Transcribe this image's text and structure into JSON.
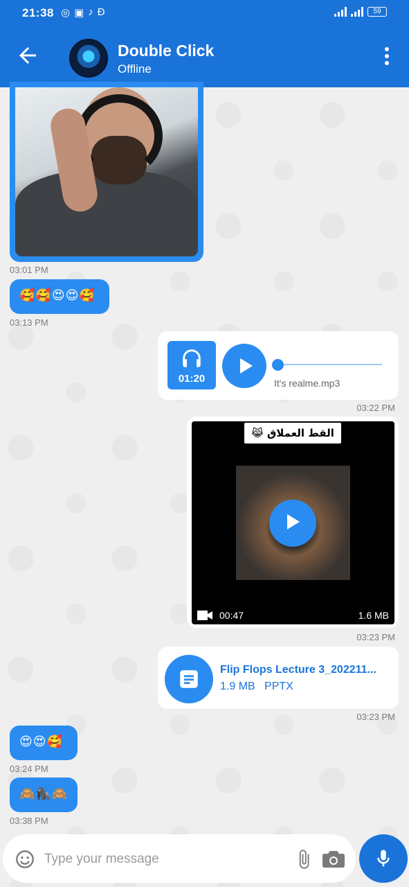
{
  "status_bar": {
    "time": "21:38",
    "battery": "59"
  },
  "header": {
    "contact_name": "Double Click",
    "contact_status": "Offline",
    "accent_color": "#1a73d9"
  },
  "messages": [
    {
      "type": "image",
      "direction": "in",
      "time": "03:01 PM"
    },
    {
      "type": "emoji",
      "direction": "in",
      "text": "🥰🥰😍😍🥰",
      "time": "03:13 PM"
    },
    {
      "type": "audio",
      "direction": "out",
      "duration": "01:20",
      "filename": "It's realme.mp3",
      "time": "03:22 PM",
      "progress": 0
    },
    {
      "type": "video",
      "direction": "out",
      "caption": "القط العملاق 😹",
      "duration": "00:47",
      "size": "1.6 MB",
      "time": "03:23 PM"
    },
    {
      "type": "file",
      "direction": "out",
      "filename": "Flip Flops Lecture 3_202211...",
      "size": "1.9 MB",
      "ext": "PPTX",
      "time": "03:23 PM"
    },
    {
      "type": "emoji",
      "direction": "in",
      "text": "😍😍🥰",
      "time": "03:24 PM"
    },
    {
      "type": "emoji",
      "direction": "in",
      "text": "🙈🦍🙈",
      "time": "03:38 PM"
    }
  ],
  "composer": {
    "placeholder": "Type your message"
  }
}
